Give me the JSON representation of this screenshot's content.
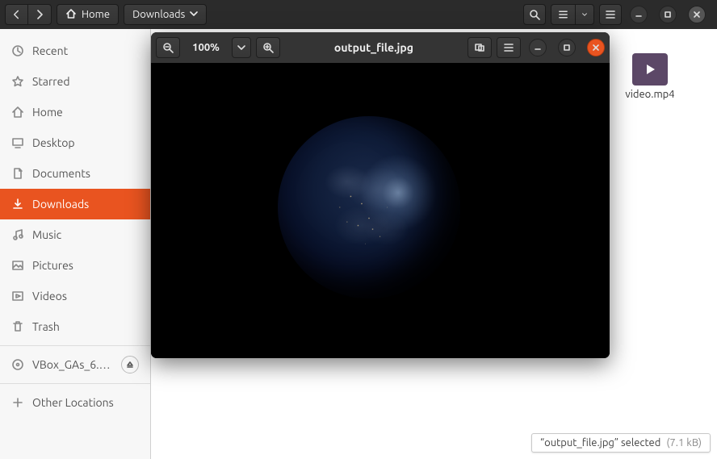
{
  "fm": {
    "path": {
      "home": "Home",
      "downloads": "Downloads"
    },
    "sidebar": {
      "recent": "Recent",
      "starred": "Starred",
      "home": "Home",
      "desktop": "Desktop",
      "documents": "Documents",
      "downloads": "Downloads",
      "music": "Music",
      "pictures": "Pictures",
      "videos": "Videos",
      "trash": "Trash",
      "disk": "VBox_GAs_6.…",
      "other": "Other Locations"
    },
    "files": {
      "video": "video.mp4"
    },
    "status": {
      "text": "“output_file.jpg” selected",
      "size": "(7.1 kB)"
    }
  },
  "viewer": {
    "zoom": "100%",
    "title": "output_file.jpg"
  }
}
